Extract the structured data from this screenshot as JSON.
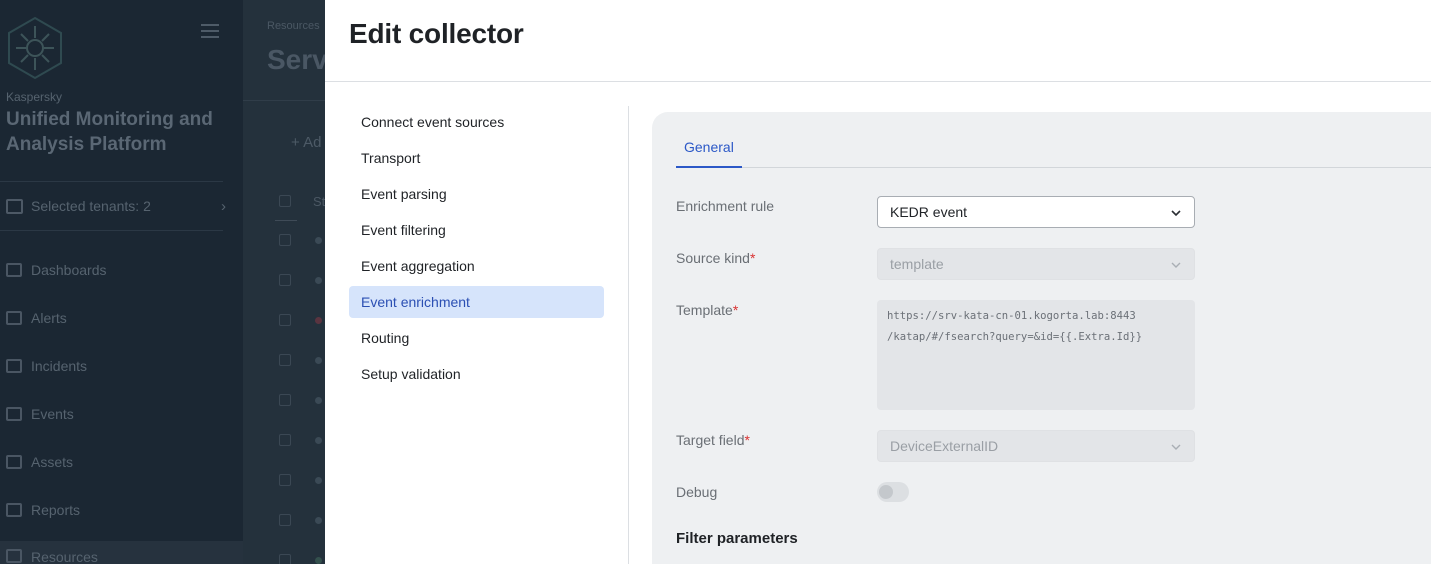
{
  "app": {
    "brand_small": "Kaspersky",
    "brand_name": "Unified Monitoring and Analysis Platform",
    "tenants_label": "Selected tenants: 2",
    "nav": [
      {
        "label": "Dashboards",
        "icon": "dashboard-icon"
      },
      {
        "label": "Alerts",
        "icon": "bell-icon"
      },
      {
        "label": "Incidents",
        "icon": "eye-icon"
      },
      {
        "label": "Events",
        "icon": "flag-icon"
      },
      {
        "label": "Assets",
        "icon": "tree-icon"
      },
      {
        "label": "Reports",
        "icon": "report-icon"
      },
      {
        "label": "Resources",
        "icon": "resources-icon"
      }
    ],
    "breadcrumb": "Resources",
    "page_title_partial": "Serv",
    "add_label_partial": "+ Ad",
    "col_header_partial": "St",
    "row_status_colors": [
      "#3b4a56",
      "#3b4a56",
      "#5a3440",
      "#3b4a56",
      "#3b4a56",
      "#3b4a56",
      "#3b4a56",
      "#3b4a56",
      "#34504d"
    ]
  },
  "drawer": {
    "title": "Edit collector",
    "steps": [
      {
        "label": "Connect event sources",
        "active": false
      },
      {
        "label": "Transport",
        "active": false
      },
      {
        "label": "Event parsing",
        "active": false
      },
      {
        "label": "Event filtering",
        "active": false
      },
      {
        "label": "Event aggregation",
        "active": false
      },
      {
        "label": "Event enrichment",
        "active": true
      },
      {
        "label": "Routing",
        "active": false
      },
      {
        "label": "Setup validation",
        "active": false
      }
    ],
    "tab": "General",
    "form": {
      "enrichment_rule": {
        "label": "Enrichment rule",
        "value": "KEDR event"
      },
      "source_kind": {
        "label": "Source kind",
        "required_mark": "*",
        "value": "template"
      },
      "template": {
        "label": "Template",
        "required_mark": "*",
        "value": "https://srv-kata-cn-01.kogorta.lab:8443\n/katap/#/fsearch?query=&id={{.Extra.Id}}"
      },
      "target_field": {
        "label": "Target field",
        "required_mark": "*",
        "value": "DeviceExternalID"
      },
      "debug": {
        "label": "Debug",
        "enabled": false
      }
    },
    "filter_section_title": "Filter parameters"
  },
  "colors": {
    "accent": "#2b58c7",
    "active_step_bg": "#d6e4fb",
    "required": "#d93232"
  }
}
